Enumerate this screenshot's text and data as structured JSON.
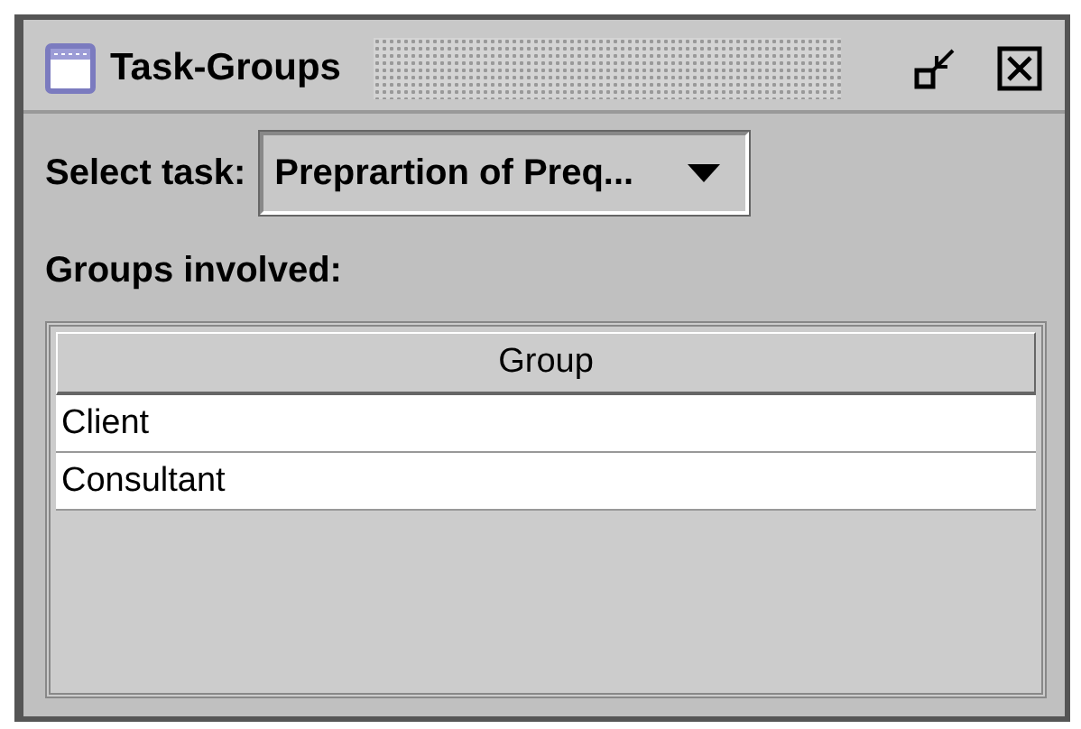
{
  "window": {
    "title": "Task-Groups"
  },
  "select_task": {
    "label": "Select task:",
    "value": "Preprartion of Preq..."
  },
  "groups_label": "Groups involved:",
  "table": {
    "columns": [
      "Group"
    ],
    "rows": [
      {
        "cells": [
          "Client"
        ]
      },
      {
        "cells": [
          "Consultant"
        ]
      }
    ]
  }
}
